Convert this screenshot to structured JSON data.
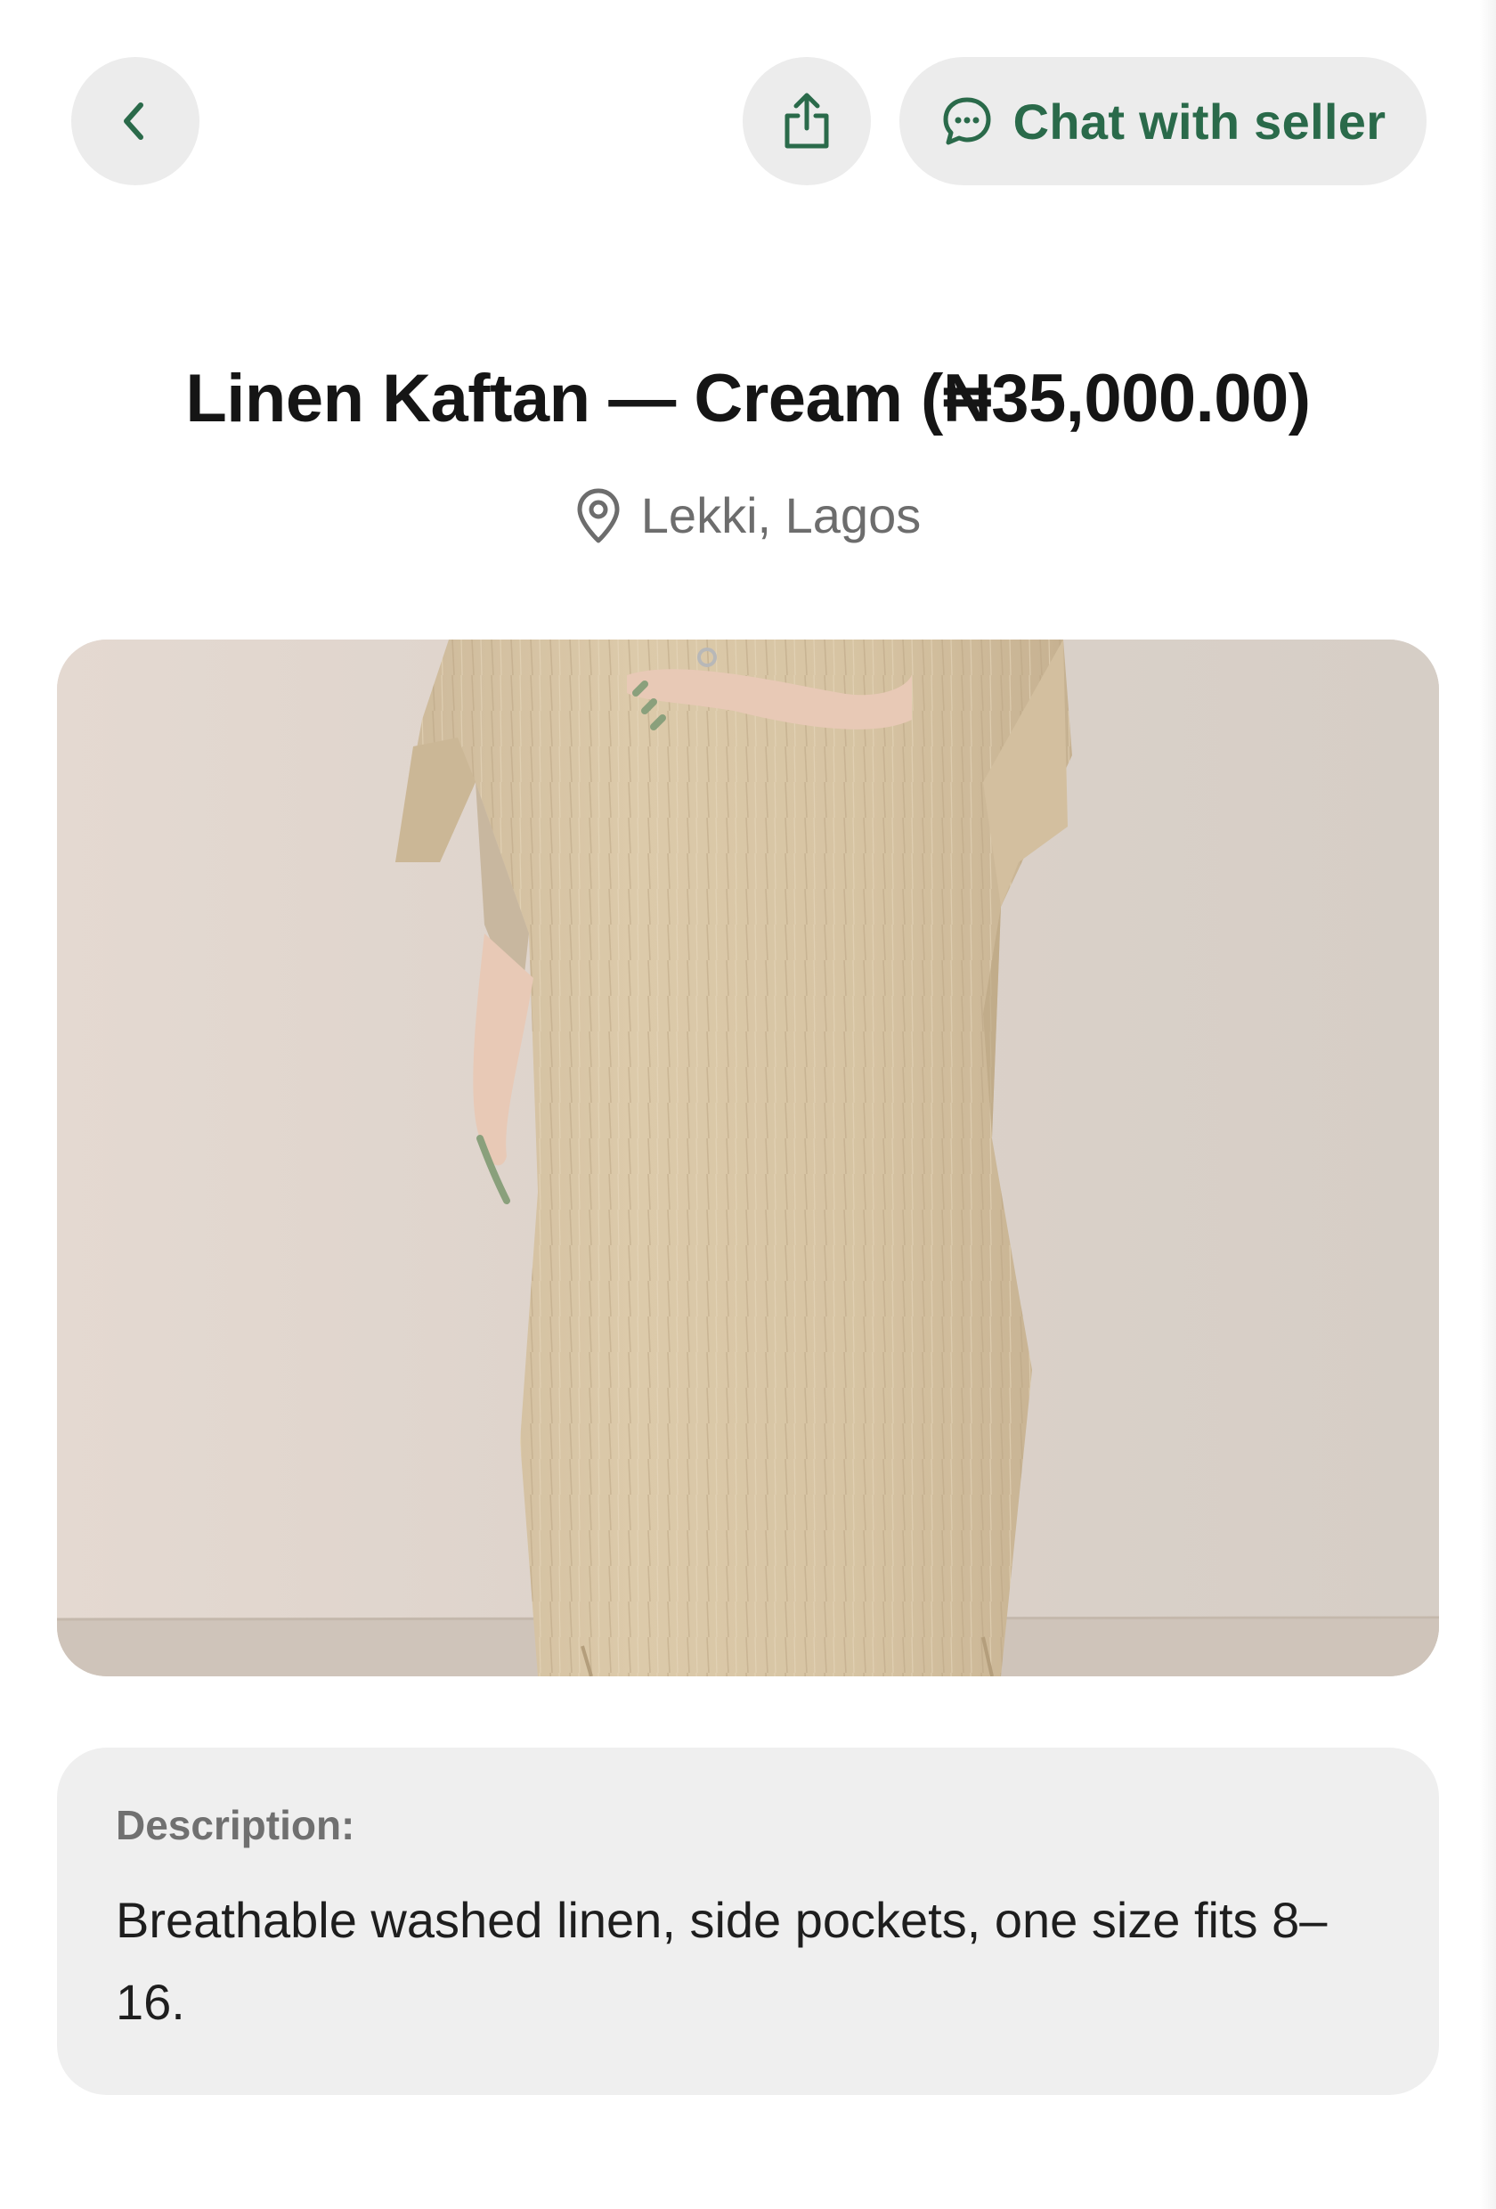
{
  "header": {
    "back_icon": "chevron-left-icon",
    "share_icon": "share-upload-icon",
    "chat_icon": "chat-bubble-icon",
    "chat_label": "Chat with seller",
    "accent_color": "#2a6a4a"
  },
  "product": {
    "title": "Linen Kaftan — Cream (₦35,000.00)",
    "location_icon": "map-pin-icon",
    "location": "Lekki, Lagos"
  },
  "description": {
    "label": "Description:",
    "text": "Breathable washed linen, side pockets, one size fits 8–16."
  }
}
